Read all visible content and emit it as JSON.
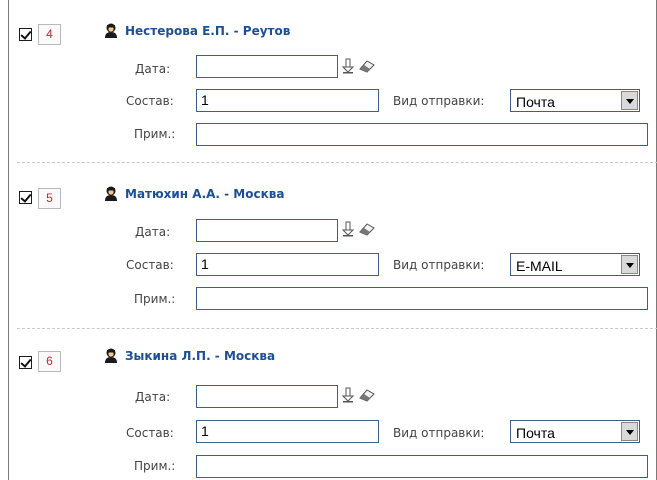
{
  "records": [
    {
      "number": "4",
      "checked": true,
      "name": "Нестерова Е.П. - Реутов",
      "date_label": "Дата:",
      "date_value": "",
      "composition_label": "Состав:",
      "composition_value": "1",
      "send_label": "Вид отправки:",
      "send_value": "Почта",
      "note_label": "Прим.:",
      "note_value": ""
    },
    {
      "number": "5",
      "checked": true,
      "name": "Матюхин А.А. - Москва",
      "date_label": "Дата:",
      "date_value": "",
      "composition_label": "Состав:",
      "composition_value": "1",
      "send_label": "Вид отправки:",
      "send_value": "E-MAIL",
      "note_label": "Прим.:",
      "note_value": ""
    },
    {
      "number": "6",
      "checked": true,
      "name": "Зыкина Л.П. - Москва",
      "date_label": "Дата:",
      "date_value": "",
      "composition_label": "Состав:",
      "composition_value": "1",
      "send_label": "Вид отправки:",
      "send_value": "Почта",
      "note_label": "Прим.:",
      "note_value": ""
    }
  ],
  "icons": {
    "person": "person-icon",
    "insert_date": "down-arrow-icon",
    "clear": "eraser-icon",
    "dropdown": "chevron-down-icon"
  },
  "colors": {
    "name_link": "#1d4f96",
    "number_text": "#c0282e",
    "field_border": "#3d5f8c",
    "divider": "#c8c8c8"
  }
}
